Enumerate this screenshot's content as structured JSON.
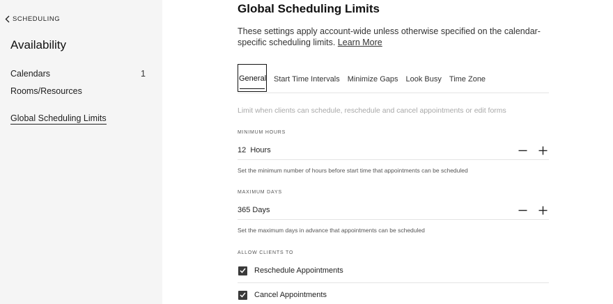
{
  "sidebar": {
    "back_label": "SCHEDULING",
    "title": "Availability",
    "items": [
      {
        "label": "Calendars",
        "count": "1"
      },
      {
        "label": "Rooms/Resources",
        "count": ""
      },
      {
        "label": "Global Scheduling Limits",
        "count": ""
      }
    ]
  },
  "main": {
    "title": "Global Scheduling Limits",
    "intro": "These settings apply account-wide unless otherwise specified on the calendar-specific scheduling limits.",
    "learn_more": "Learn More",
    "tabs": [
      {
        "label": "General",
        "active": true
      },
      {
        "label": "Start Time Intervals",
        "active": false
      },
      {
        "label": "Minimize Gaps",
        "active": false
      },
      {
        "label": "Look Busy",
        "active": false
      },
      {
        "label": "Time Zone",
        "active": false
      }
    ],
    "helper": "Limit when clients can schedule, reschedule and cancel appointments or edit forms",
    "minimum_hours": {
      "label": "MINIMUM HOURS",
      "value": "12  Hours",
      "note": "Set the minimum number of hours before start time that appointments can be scheduled"
    },
    "maximum_days": {
      "label": "MAXIMUM DAYS",
      "value": "365 Days",
      "note": "Set the maximum days in advance that appointments can be scheduled"
    },
    "allow_clients": {
      "label": "ALLOW CLIENTS TO",
      "options": [
        {
          "label": "Reschedule Appointments",
          "checked": true
        },
        {
          "label": "Cancel Appointments",
          "checked": true
        }
      ]
    }
  },
  "icons": {
    "back": "chevron-left-icon",
    "decrement": "minus-icon",
    "increment": "plus-icon",
    "check": "checkmark-icon"
  }
}
